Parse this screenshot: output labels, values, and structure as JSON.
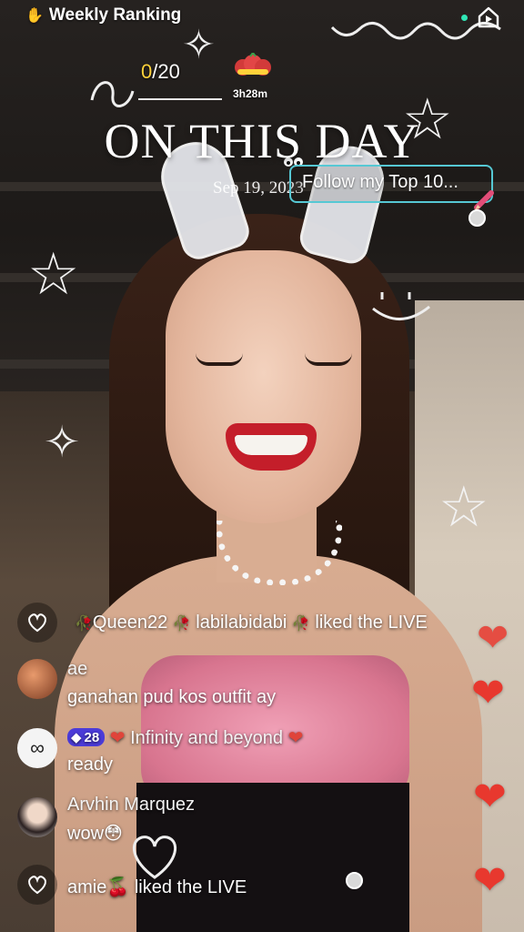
{
  "header": {
    "ranking_label": "Weekly Ranking",
    "counter_value": "0",
    "counter_rest": "/20",
    "timer": "3h28m"
  },
  "overlay": {
    "headline": "ON THIS DAY",
    "date": "Sep 19, 2023",
    "sticker_text": "Follow my Top 10..."
  },
  "comments": [
    {
      "type": "like",
      "name1": "Queen22",
      "name2": "labilabidabi",
      "action": "liked the LIVE"
    },
    {
      "type": "chat",
      "username": "ae",
      "message": "ganahan pud kos outfit ay"
    },
    {
      "type": "chat",
      "badge_level": "28",
      "username": "Infinity and beyond",
      "message": "ready"
    },
    {
      "type": "chat",
      "username": "Arvhin Marquez",
      "message": "wow",
      "emoji": "😳"
    },
    {
      "type": "like",
      "username": "amie",
      "action": "liked the LIVE"
    }
  ],
  "colors": {
    "accent_yellow": "#ffd23a",
    "sticker_border": "#56c8d4",
    "heart_red": "#e8382e",
    "badge_purple": "#4b3bd8",
    "live_dot": "#2fe6b5"
  },
  "icons": {
    "ranking": "hand-icon",
    "top_right": "home-play-icon",
    "comment_like": "heart-outline-icon",
    "sticker": "pencil-icon"
  }
}
